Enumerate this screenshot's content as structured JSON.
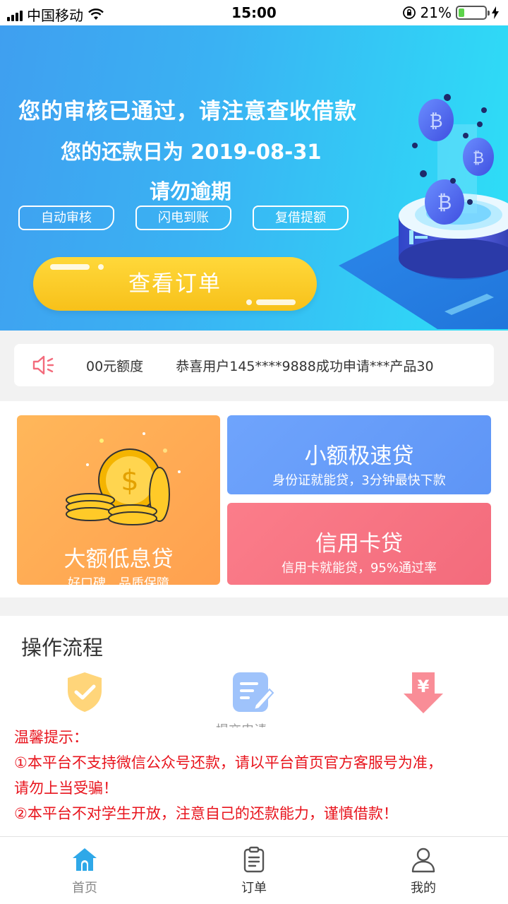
{
  "status_bar": {
    "carrier": "中国移动",
    "time": "15:00",
    "battery_percent": "21%",
    "battery_level": 0.21
  },
  "banner": {
    "line1": "您的审核已通过，请注意查收借款",
    "line2": "您的还款日为 2019-08-31",
    "line3": "请勿逾期",
    "tags": [
      "自动审核",
      "闪电到账",
      "复借提额"
    ],
    "order_button": "查看订单"
  },
  "notice": {
    "icon": "speaker-icon",
    "text_part1": "00元额度",
    "text_part2": "恭喜用户145****9888成功申请***产品30"
  },
  "products": {
    "big": {
      "title": "大额低息贷",
      "subtitle": "好口碑，品质保障"
    },
    "small": {
      "title": "小额极速贷",
      "subtitle": "身份证就能贷，3分钟最快下款"
    },
    "credit": {
      "title": "信用卡贷",
      "subtitle": "信用卡就能贷，95%通过率"
    }
  },
  "process": {
    "heading": "操作流程",
    "step_icons": [
      "shield-check-icon",
      "form-edit-icon",
      "yuan-download-icon"
    ],
    "step2_partial_label": "提交申请"
  },
  "tips": {
    "title": "温馨提示：",
    "line1": "①本平台不支持微信公众号还款，请以平台首页官方客服号为准，",
    "line1b": "请勿上当受骗！",
    "line2": "②本平台不对学生开放，注意自己的还款能力，谨慎借款！"
  },
  "tabbar": {
    "items": [
      {
        "label": "首页",
        "icon": "home-icon",
        "active": true
      },
      {
        "label": "订单",
        "icon": "clipboard-icon",
        "active": false
      },
      {
        "label": "我的",
        "icon": "user-icon",
        "active": false
      }
    ]
  },
  "colors": {
    "banner_start": "#3f9ff0",
    "banner_end": "#2de0f7",
    "button_yellow": "#fcc824",
    "card_orange": "#ffa64f",
    "card_blue": "#6fa4fc",
    "card_pink": "#f7737f",
    "tip_red": "#e8141d",
    "tab_active": "#2fa8e8"
  }
}
